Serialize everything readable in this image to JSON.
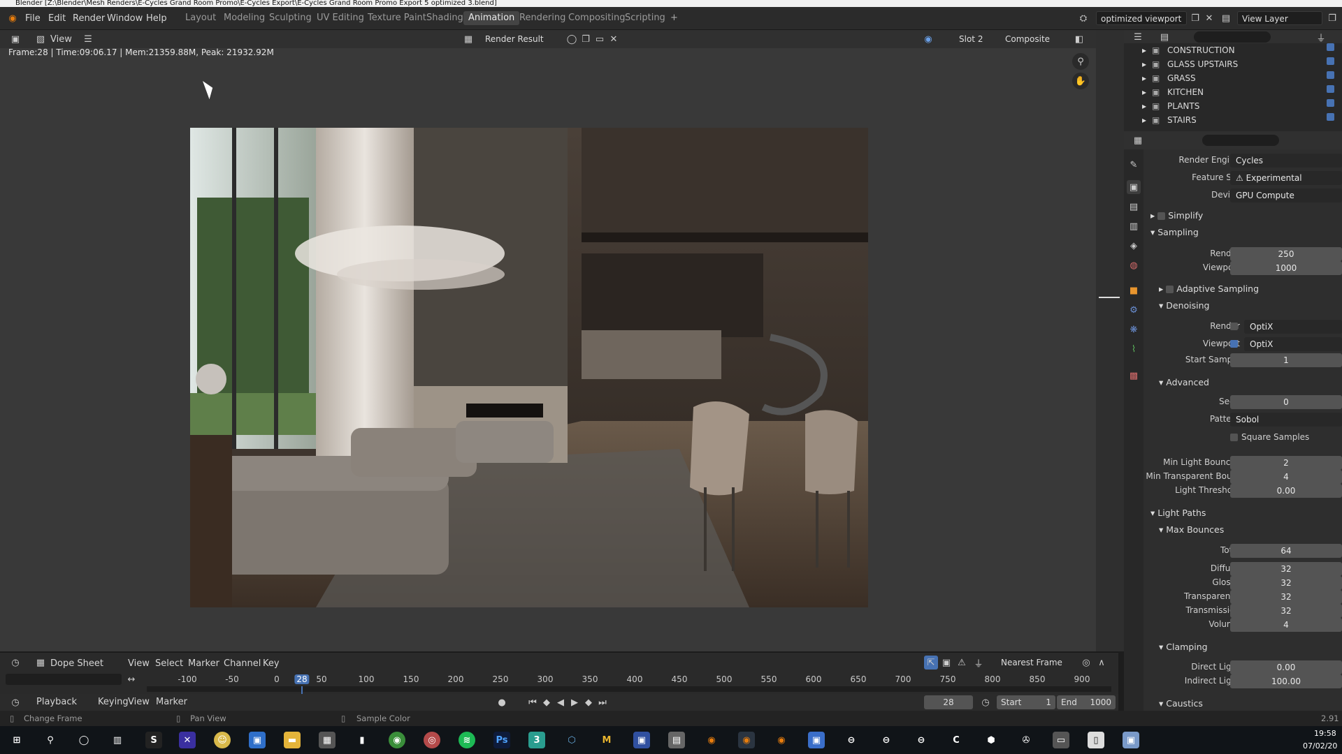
{
  "window": {
    "title": "Blender [Z:\\Blender\\Mesh Renders\\E-Cycles Grand Room Promo\\E-Cycles Export\\E-Cycles Grand Room Promo Export 5 optimized 3.blend]"
  },
  "menu": [
    "File",
    "Edit",
    "Render",
    "Window",
    "Help"
  ],
  "workspaces": [
    "Layout",
    "Modeling",
    "Sculpting",
    "UV Editing",
    "Texture Paint",
    "Shading",
    "Animation",
    "Rendering",
    "Compositing",
    "Scripting"
  ],
  "active_workspace": "Animation",
  "scene_name": "optimized viewport",
  "view_layer": "View Layer",
  "image_editor": {
    "view_label": "View",
    "image_name": "Render Result",
    "slot": "Slot 2",
    "pass": "Composite",
    "stats": "Frame:28 | Time:09:06.17 | Mem:21359.88M, Peak: 21932.92M"
  },
  "outliner": {
    "items": [
      "CONSTRUCTION",
      "GLASS UPSTAIRS",
      "GRASS",
      "KITCHEN",
      "PLANTS",
      "STAIRS"
    ]
  },
  "properties": {
    "render_engine_label": "Render Engine",
    "render_engine": "Cycles",
    "feature_set_label": "Feature Set",
    "feature_set": "Experimental",
    "device_label": "Device",
    "device": "GPU Compute",
    "simplify": "Simplify",
    "sampling": "Sampling",
    "render_label": "Render",
    "render_samples": "250",
    "viewport_label": "Viewport",
    "viewport_samples": "1000",
    "adaptive_sampling": "Adaptive Sampling",
    "denoising": "Denoising",
    "denoise_render": "OptiX",
    "denoise_viewport": "OptiX",
    "start_sample_label": "Start Sample",
    "start_sample": "1",
    "advanced": "Advanced",
    "seed_label": "Seed",
    "seed": "0",
    "pattern_label": "Pattern",
    "pattern": "Sobol",
    "square_samples": "Square Samples",
    "min_light_bounces_label": "Min Light Bounces",
    "min_light_bounces": "2",
    "min_transparent_label": "Min Transparent Bou...",
    "min_transparent": "4",
    "light_threshold_label": "Light Threshold",
    "light_threshold": "0.00",
    "light_paths": "Light Paths",
    "max_bounces": "Max Bounces",
    "total_label": "Total",
    "total": "64",
    "diffuse_label": "Diffuse",
    "diffuse": "32",
    "glossy_label": "Glossy",
    "glossy": "32",
    "transparency_label": "Transparency",
    "transparency": "32",
    "transmission_label": "Transmission",
    "transmission": "32",
    "volume_label": "Volume",
    "volume": "4",
    "clamping": "Clamping",
    "direct_light_label": "Direct Light",
    "direct_light": "0.00",
    "indirect_light_label": "Indirect Light",
    "indirect_light": "100.00",
    "caustics": "Caustics"
  },
  "timeline": {
    "editor": "Dope Sheet",
    "menus": [
      "View",
      "Select",
      "Marker",
      "Channel",
      "Key"
    ],
    "snap": "Nearest Frame",
    "ticks": [
      "-100",
      "-50",
      "0",
      "28",
      "50",
      "100",
      "150",
      "200",
      "250",
      "300",
      "350",
      "400",
      "450",
      "500",
      "550",
      "600",
      "650",
      "700",
      "750",
      "800",
      "850",
      "900"
    ],
    "current_frame": "28",
    "playback": "Playback",
    "keying": "Keying",
    "view": "View",
    "marker": "Marker",
    "start_label": "Start",
    "start": "1",
    "end_label": "End",
    "end": "1000"
  },
  "status": {
    "left": "Change Frame",
    "mid": "Pan View",
    "right": "Sample Color",
    "version": "2.91"
  },
  "taskbar": {
    "time": "19:58",
    "date": "07/02/20"
  }
}
